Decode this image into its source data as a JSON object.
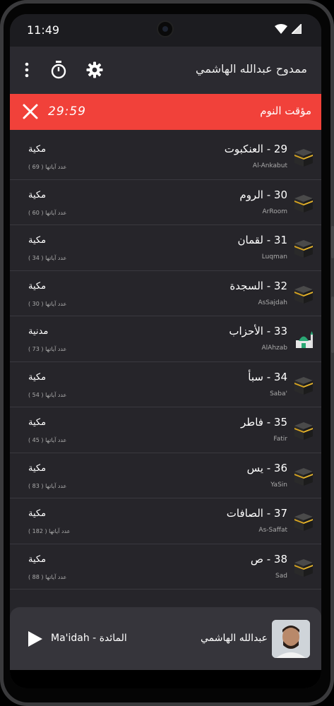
{
  "status_bar": {
    "time": "11:49"
  },
  "toolbar": {
    "title": "ممدوح عبدالله الهاشمي"
  },
  "sleep_timer": {
    "label": "مؤقت النوم",
    "countdown": "29:59"
  },
  "surahs": [
    {
      "name": "29 - العنكبوت",
      "latin": "Al-Ankabut",
      "place": "مكية",
      "verses": "عدد آياتها ( 69 )",
      "icon": "kaaba-icon"
    },
    {
      "name": "30 - الروم",
      "latin": "ArRoom",
      "place": "مكية",
      "verses": "عدد آياتها ( 60 )",
      "icon": "kaaba-icon"
    },
    {
      "name": "31 - لقمان",
      "latin": "Luqman",
      "place": "مكية",
      "verses": "عدد آياتها ( 34 )",
      "icon": "kaaba-icon"
    },
    {
      "name": "32 - السجدة",
      "latin": "AsSajdah",
      "place": "مكية",
      "verses": "عدد آياتها ( 30 )",
      "icon": "kaaba-icon"
    },
    {
      "name": "33 - الأحزاب",
      "latin": "AlAhzab",
      "place": "مدنية",
      "verses": "عدد آياتها ( 73 )",
      "icon": "mosque-icon"
    },
    {
      "name": "34 - سبأ",
      "latin": "Saba'",
      "place": "مكية",
      "verses": "عدد آياتها ( 54 )",
      "icon": "kaaba-icon"
    },
    {
      "name": "35 - فاطر",
      "latin": "Fatir",
      "place": "مكية",
      "verses": "عدد آياتها ( 45 )",
      "icon": "kaaba-icon"
    },
    {
      "name": "36 - يس",
      "latin": "YaSin",
      "place": "مكية",
      "verses": "عدد آياتها ( 83 )",
      "icon": "kaaba-icon"
    },
    {
      "name": "37 - الصافات",
      "latin": "As-Saffat",
      "place": "مكية",
      "verses": "عدد آياتها ( 182 )",
      "icon": "kaaba-icon"
    },
    {
      "name": "38 - ص",
      "latin": "Sad",
      "place": "مكية",
      "verses": "عدد آياتها ( 88 )",
      "icon": "kaaba-icon"
    }
  ],
  "player": {
    "track": "Ma'idah - المائدة",
    "reciter": "عبدالله الهاشمي"
  },
  "colors": {
    "accent": "#f1413a",
    "background": "#26252a",
    "toolbar": "#2b2a30",
    "player": "#36353b"
  }
}
